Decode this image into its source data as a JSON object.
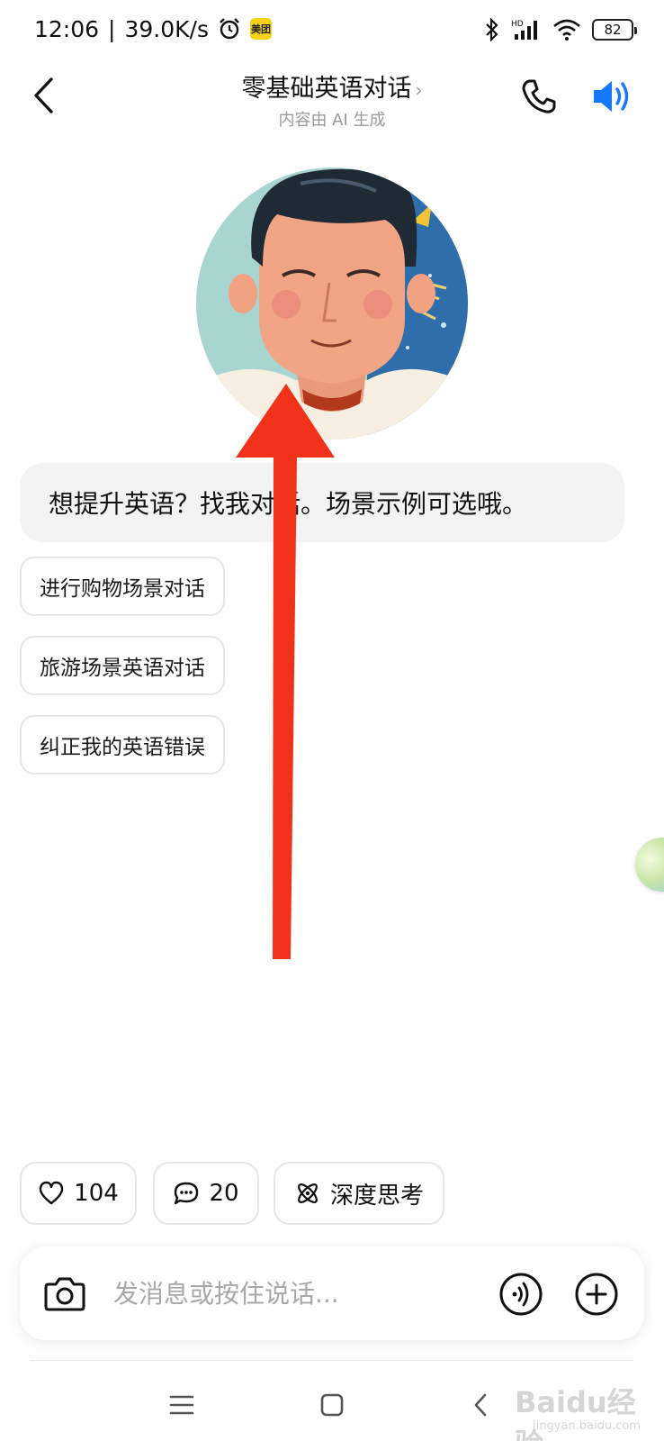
{
  "status_bar": {
    "time": "12:06",
    "separator": "|",
    "net_speed": "39.0K/s",
    "app_badge": "美团",
    "battery": "82"
  },
  "header": {
    "title": "零基础英语对话",
    "title_chevron": "›",
    "subtitle": "内容由 AI 生成"
  },
  "greeting": "想提升英语？找我对话。场景示例可选哦。",
  "suggestions": [
    "进行购物场景对话",
    "旅游场景英语对话",
    "纠正我的英语错误"
  ],
  "actions": {
    "likes": "104",
    "comments": "20",
    "deep_think": "深度思考"
  },
  "input": {
    "placeholder": "发消息或按住说话..."
  },
  "watermark": {
    "text": "Baidu经验",
    "sub": "jingyan.baidu.com"
  },
  "colors": {
    "accent_blue": "#1677ff",
    "arrow_red": "#f0321a",
    "bubble_bg": "#f3f3f4"
  }
}
